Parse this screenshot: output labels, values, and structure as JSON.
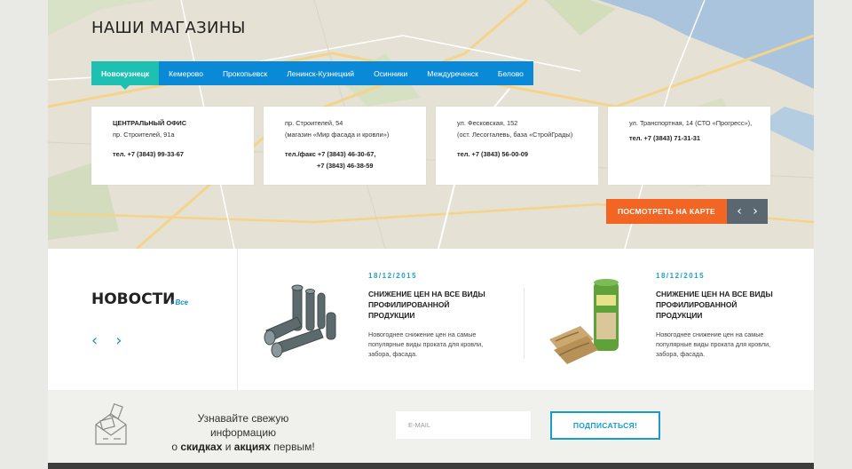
{
  "stores": {
    "title": "НАШИ МАГАЗИНЫ",
    "tabs": [
      {
        "label": "Новокузнецк",
        "active": true
      },
      {
        "label": "Кемерово",
        "active": false
      },
      {
        "label": "Прокопьевск",
        "active": false
      },
      {
        "label": "Ленинск-Кузнецкий",
        "active": false
      },
      {
        "label": "Осинники",
        "active": false
      },
      {
        "label": "Междуреченск",
        "active": false
      },
      {
        "label": "Белово",
        "active": false
      }
    ],
    "cards": [
      {
        "line1": "ЦЕНТРАЛЬНЫЙ ОФИС",
        "line2": "пр. Строителей, 91а",
        "phone": "тел. +7 (3843) 99-33-67"
      },
      {
        "line1": "пр. Строителей, 54",
        "line2": "(магазин «Мир фасада и кровли»)",
        "phone": "тел./факс +7 (3843) 46-30-67,",
        "phone2": "+7 (3843) 46-38-59"
      },
      {
        "line1": "ул. Фесковская, 152",
        "line2": "(ост. Лесоггалевь, база «СтройГрады)",
        "phone": "тел. +7 (3843) 56-00-09"
      },
      {
        "line1": "ул. Транспортная, 14 (СТО «Прогресс»),",
        "phone": "тел. +7 (3843) 71-31-31"
      }
    ],
    "map_button": "ПОСМОТРЕТЬ НА КАРТЕ",
    "prev_arrow": "‹",
    "next_arrow": "›"
  },
  "news": {
    "title": "НОВОСТИ",
    "all_link": "/ Все",
    "prev_arrow": "‹",
    "next_arrow": "›",
    "items": [
      {
        "date": "18/12/2015",
        "headline": "СНИЖЕНИЕ ЦЕН НА ВСЕ ВИДЫ ПРОФИЛИРОВАННОЙ ПРОДУКЦИИ",
        "text": "Новогоднее снижение цен на самые популярные виды проката для кровли, забора, фасада."
      },
      {
        "date": "18/12/2015",
        "headline": "СНИЖЕНИЕ ЦЕН НА ВСЕ ВИДЫ ПРОФИЛИРОВАННОЙ ПРОДУКЦИИ",
        "text": "Новогоднее снижение цен на самые популярные виды проката для кровли, забора, фасада."
      }
    ]
  },
  "subscribe": {
    "line1": "Узнавайте свежую информацию",
    "line2_pre": "о",
    "line2_b1": "скидках",
    "line2_mid": "и",
    "line2_b2": "акциях",
    "line2_post": "первым!",
    "placeholder": "E-MAIL",
    "button": "ПОДПИСАТЬСЯ!"
  },
  "colors": {
    "tab_bar": "#0a8ad6",
    "tab_active": "#1ec0b2",
    "map_button": "#f26522",
    "accent": "#1a9cc8"
  }
}
